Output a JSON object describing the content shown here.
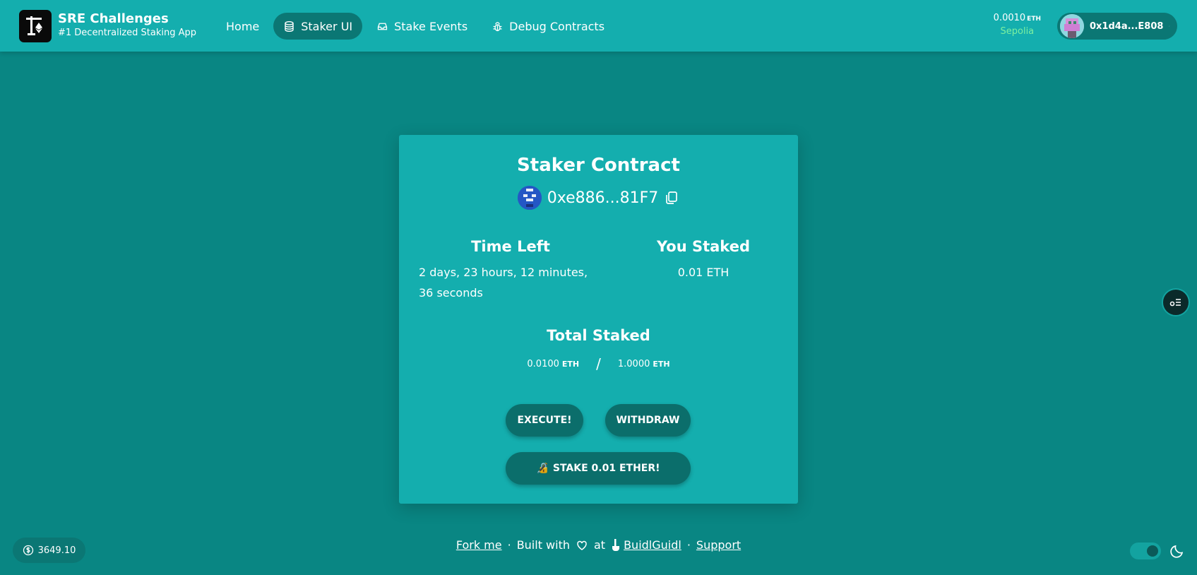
{
  "header": {
    "brand_title": "SRE Challenges",
    "brand_subtitle": "#1 Decentralized Staking App",
    "nav": [
      {
        "label": "Home",
        "icon": "none",
        "active": false
      },
      {
        "label": "Staker UI",
        "icon": "database-icon",
        "active": true
      },
      {
        "label": "Stake Events",
        "icon": "inbox-stack-icon",
        "active": false
      },
      {
        "label": "Debug Contracts",
        "icon": "bug-icon",
        "active": false
      }
    ],
    "balance_value": "0.0010",
    "balance_unit": "ETH",
    "network": "Sepolia",
    "account_address": "0x1d4a...E808"
  },
  "card": {
    "title": "Staker Contract",
    "contract_address": "0xe886...81F7",
    "time_left_label": "Time Left",
    "time_left_value": "2 days, 23 hours, 12 minutes, 36 seconds",
    "you_staked_label": "You Staked",
    "you_staked_value": "0.01 ETH",
    "total_staked_label": "Total Staked",
    "total_staked_value": "0.0100",
    "total_staked_unit": "ETH",
    "separator": "/",
    "threshold_value": "1.0000",
    "threshold_unit": "ETH",
    "execute_label": "EXECUTE!",
    "withdraw_label": "WITHDRAW",
    "stake_icon": "🔏",
    "stake_label": "STAKE 0.01 ETHER!"
  },
  "footer": {
    "fork_label": "Fork me",
    "dot": "·",
    "built_with": "Built with",
    "at": "at",
    "buidl_label": "BuidlGuidl",
    "support_label": "Support"
  },
  "price": "3649.10",
  "colors": {
    "background": "#098683",
    "card": "#14aeae",
    "button": "#0b6e6b",
    "network": "#7cf0a0"
  }
}
